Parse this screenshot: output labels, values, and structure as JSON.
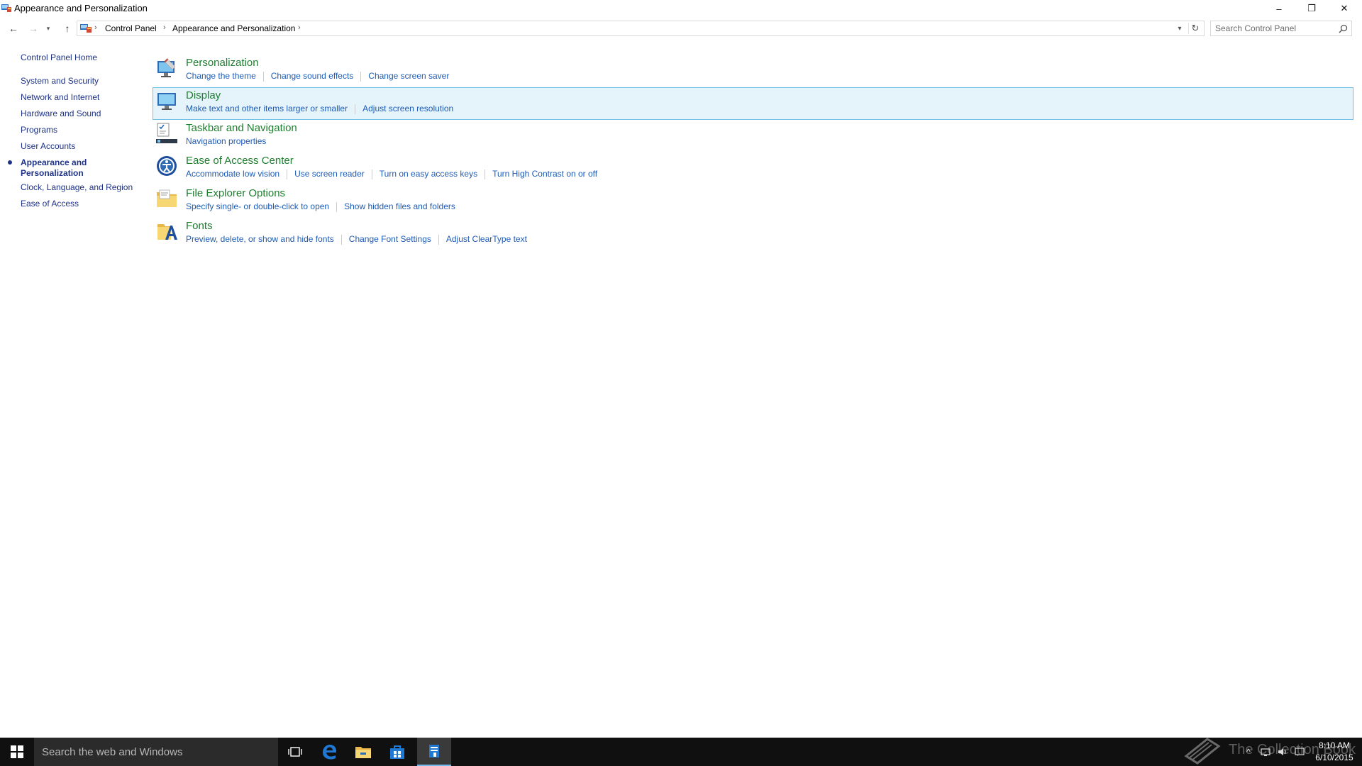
{
  "window": {
    "title": "Appearance and Personalization",
    "controls": {
      "minimize": "–",
      "maximize": "❐",
      "close": "✕"
    }
  },
  "navigation": {
    "back": "←",
    "forward": "→",
    "recent": "▾",
    "up": "↑",
    "breadcrumb": [
      "Control Panel",
      "Appearance and Personalization"
    ],
    "separator": "›",
    "dropdown": "▾",
    "refresh": "↻",
    "search_placeholder": "Search Control Panel"
  },
  "sidebar": {
    "home": "Control Panel Home",
    "items": [
      "System and Security",
      "Network and Internet",
      "Hardware and Sound",
      "Programs",
      "User Accounts",
      "Appearance and Personalization",
      "Clock, Language, and Region",
      "Ease of Access"
    ],
    "current_index": 5,
    "current_lines": [
      "Appearance and",
      "Personalization"
    ]
  },
  "categories": [
    {
      "title": "Personalization",
      "icon": "personalization-icon",
      "tasks": [
        "Change the theme",
        "Change sound effects",
        "Change screen saver"
      ]
    },
    {
      "title": "Display",
      "icon": "display-icon",
      "highlighted": true,
      "tasks": [
        "Make text and other items larger or smaller",
        "Adjust screen resolution"
      ]
    },
    {
      "title": "Taskbar and Navigation",
      "icon": "taskbar-icon",
      "tasks": [
        "Navigation properties"
      ]
    },
    {
      "title": "Ease of Access Center",
      "icon": "ease-of-access-icon",
      "tasks": [
        "Accommodate low vision",
        "Use screen reader",
        "Turn on easy access keys",
        "Turn High Contrast on or off"
      ]
    },
    {
      "title": "File Explorer Options",
      "icon": "folder-options-icon",
      "tasks": [
        "Specify single- or double-click to open",
        "Show hidden files and folders"
      ]
    },
    {
      "title": "Fonts",
      "icon": "fonts-icon",
      "tasks": [
        "Preview, delete, or show and hide fonts",
        "Change Font Settings",
        "Adjust ClearType text"
      ]
    }
  ],
  "taskbar": {
    "search_placeholder": "Search the web and Windows",
    "apps": [
      "task-view-icon",
      "edge-icon",
      "file-explorer-icon",
      "store-icon",
      "control-panel-icon"
    ],
    "watermark": "The Collection Book",
    "tray": {
      "chevron": "^",
      "time": "8:10 AM",
      "date": "6/10/2015"
    }
  },
  "colors": {
    "link": "#1e5bb4",
    "category_title": "#1e7d2e",
    "sidebar_link": "#1e3287",
    "highlight_bg": "#e5f3fb",
    "highlight_border": "#70c0e7",
    "taskbar_bg": "#101010"
  }
}
